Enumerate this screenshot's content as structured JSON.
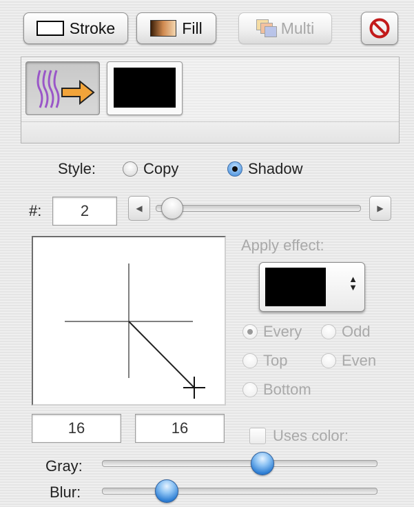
{
  "toolbar": {
    "stroke_label": "Stroke",
    "fill_label": "Fill",
    "multi_label": "Multi"
  },
  "preview": {
    "effect_icon": "shadow-effect-arrow-icon",
    "selected_color": "#000000"
  },
  "style": {
    "label": "Style:",
    "options": [
      "Copy",
      "Shadow"
    ],
    "selected": "Shadow"
  },
  "count": {
    "label": "#:",
    "value": "2",
    "slider_fraction": 0.0
  },
  "apply_effect": {
    "label": "Apply effect:",
    "color": "#000000",
    "options": [
      "Every",
      "Odd",
      "Top",
      "Even",
      "Bottom"
    ],
    "selected": "Every"
  },
  "offset": {
    "x": "16",
    "y": "16"
  },
  "uses_color": {
    "label": "Uses color:",
    "checked": false
  },
  "gray": {
    "label": "Gray:",
    "fraction": 0.59
  },
  "blur": {
    "label": "Blur:",
    "fraction": 0.21
  }
}
